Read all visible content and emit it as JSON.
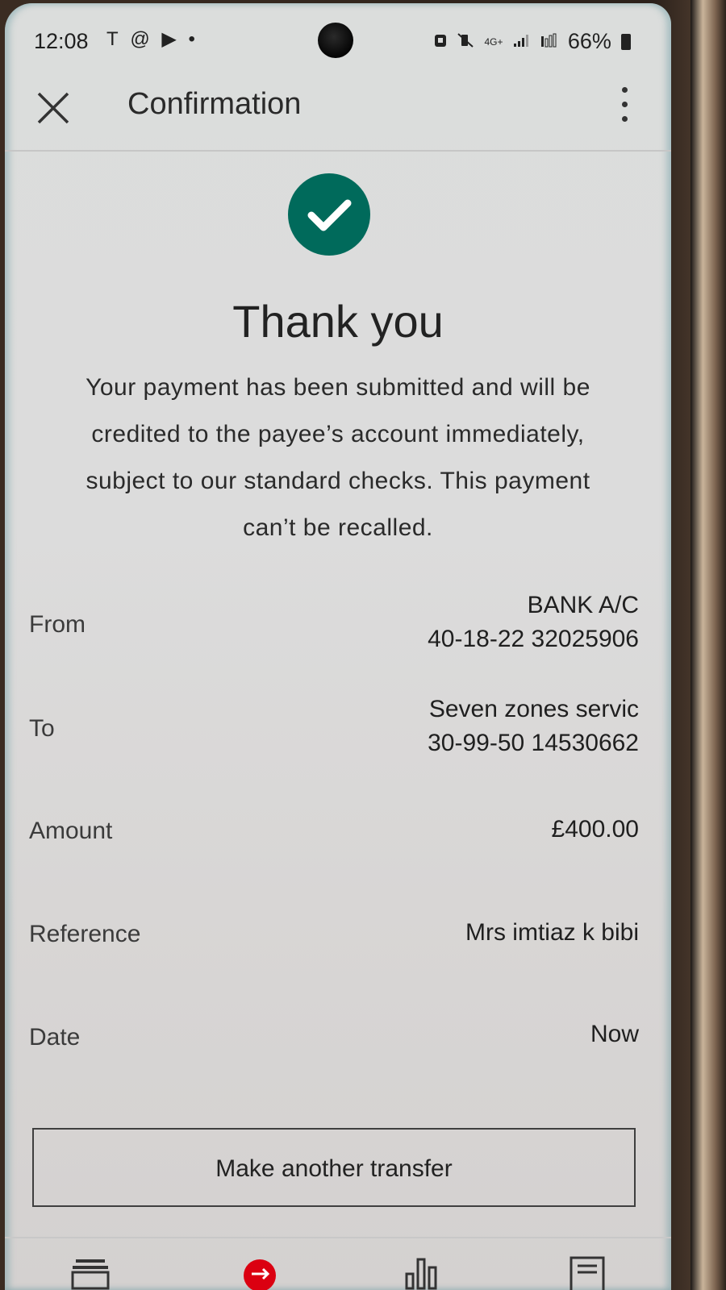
{
  "status_bar": {
    "time": "12:08",
    "left_icons": [
      "T",
      "@",
      "▶",
      "•"
    ],
    "network": "4G+",
    "battery": "66%"
  },
  "app_bar": {
    "title": "Confirmation",
    "close_icon": "close-icon",
    "menu_icon": "more-vertical-icon"
  },
  "success": {
    "icon": "check-circle-icon",
    "icon_color": "#006a5b",
    "heading": "Thank you",
    "message": "Your payment has been submitted and will be credited to the payee’s account immediately, subject to our standard checks. This payment can’t be recalled."
  },
  "details": {
    "from": {
      "label": "From",
      "line1": "BANK A/C",
      "line2": "40-18-22 32025906"
    },
    "to": {
      "label": "To",
      "line1": "Seven zones servic",
      "line2": "30-99-50 14530662"
    },
    "amount": {
      "label": "Amount",
      "value": "£400.00"
    },
    "reference": {
      "label": "Reference",
      "value": "Mrs imtiaz k bibi"
    },
    "date": {
      "label": "Date",
      "value": "Now"
    }
  },
  "actions": {
    "make_another_transfer": "Make another transfer"
  },
  "bottom_nav": {
    "items": [
      "accounts-icon",
      "pay-transfer-icon",
      "insights-icon",
      "documents-icon"
    ],
    "accent": "#db0011"
  }
}
